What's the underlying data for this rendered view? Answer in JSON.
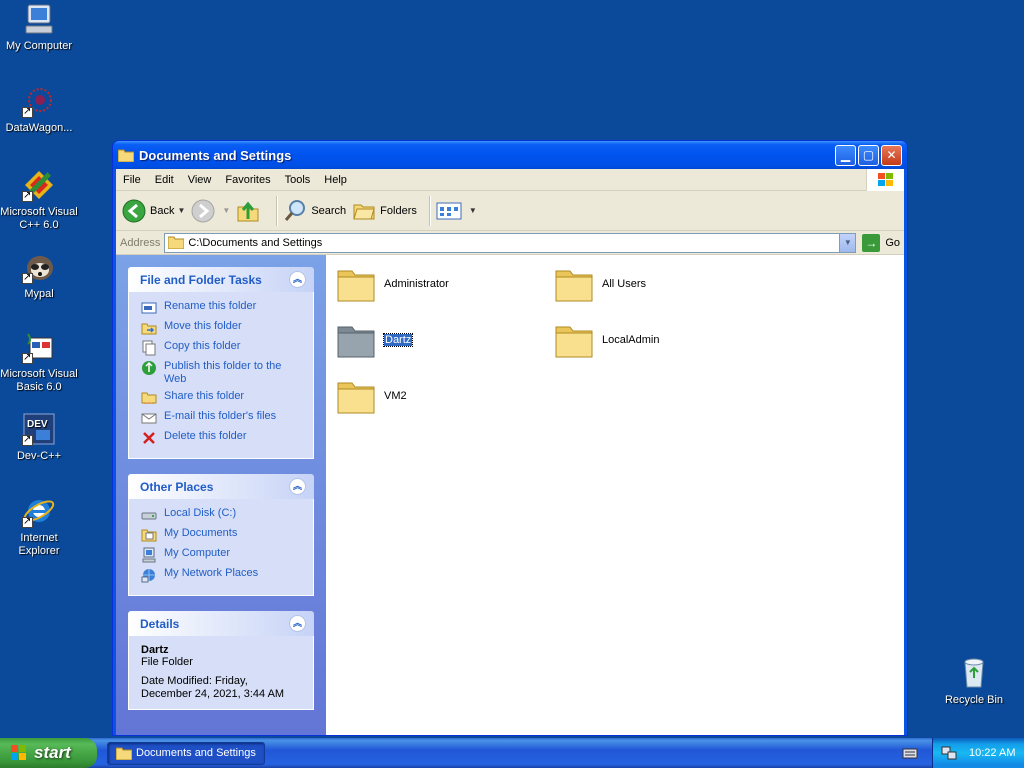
{
  "desktop": {
    "icons": [
      {
        "label": "My Computer",
        "icon": "computer-icon"
      },
      {
        "label": "DataWagon...",
        "icon": "datawagon-icon"
      },
      {
        "label": "Microsoft Visual C++ 6.0",
        "icon": "visual-cpp-icon"
      },
      {
        "label": "Mypal",
        "icon": "mypal-icon"
      },
      {
        "label": "Microsoft Visual Basic 6.0",
        "icon": "visual-basic-icon"
      },
      {
        "label": "Dev-C++",
        "icon": "dev-cpp-icon"
      },
      {
        "label": "Internet Explorer",
        "icon": "ie-icon"
      },
      {
        "label": "Recycle Bin",
        "icon": "recycle-bin-icon"
      }
    ]
  },
  "window": {
    "title": "Documents and Settings",
    "menu": [
      "File",
      "Edit",
      "View",
      "Favorites",
      "Tools",
      "Help"
    ],
    "toolbar": {
      "back": "Back",
      "search": "Search",
      "folders": "Folders"
    },
    "address": {
      "label": "Address",
      "value": "C:\\Documents and Settings",
      "go": "Go"
    },
    "tasks_panel": {
      "title": "File and Folder Tasks",
      "items": [
        "Rename this folder",
        "Move this folder",
        "Copy this folder",
        "Publish this folder to the Web",
        "Share this folder",
        "E-mail this folder's files",
        "Delete this folder"
      ]
    },
    "places_panel": {
      "title": "Other Places",
      "items": [
        "Local Disk (C:)",
        "My Documents",
        "My Computer",
        "My Network Places"
      ]
    },
    "details_panel": {
      "title": "Details",
      "name": "Dartz",
      "type": "File Folder",
      "modified_1": "Date Modified: Friday,",
      "modified_2": "December 24, 2021, 3:44 AM"
    },
    "folders": [
      "Administrator",
      "All Users",
      "Dartz",
      "LocalAdmin",
      "VM2"
    ],
    "selected_folder": "Dartz"
  },
  "taskbar": {
    "start": "start",
    "active_task": "Documents and Settings",
    "clock": "10:22 AM"
  },
  "colors": {
    "desktop": "#0B4A9A",
    "title_bar": "#0053EE",
    "task_link": "#215DC6",
    "selection": "#316AC5"
  }
}
